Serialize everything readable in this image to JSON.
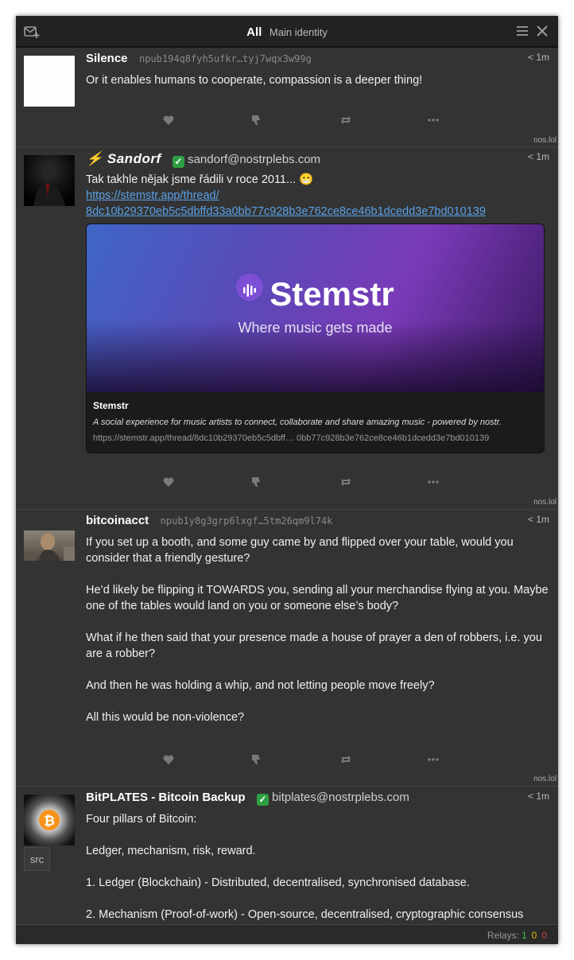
{
  "header": {
    "tab_all": "All",
    "tab_identity": "Main identity"
  },
  "posts": [
    {
      "name": "Silence",
      "npub": "npub194q8fyh5ufkr…tyj7wqx3w99g",
      "time": "< 1m",
      "content": [
        "Or it enables humans to cooperate, compassion is a deeper thing!"
      ],
      "relay": "nos.lol"
    },
    {
      "name": "⚡ Sandorf",
      "nip05": "sandorf@nostrplebs.com",
      "time": "< 1m",
      "text": "Tak takhle nějak jsme řádili v roce 2011... 😁",
      "link_line1": "https://stemstr.app/thread/",
      "link_line2": "8dc10b29370eb5c5dbffd33a0bb77c928b3e762ce8ce46b1dcedd3e7bd010139",
      "preview": {
        "brand": "Stemstr",
        "tagline": "Where music gets made",
        "title": "Stemstr",
        "description": "A social experience for music artists to connect, collaborate and share amazing music - powered by nostr.",
        "url": "https://stemstr.app/thread/8dc10b29370eb5c5dbff… 0bb77c928b3e762ce8ce46b1dcedd3e7bd010139"
      },
      "relay": "nos.lol"
    },
    {
      "name": "bitcoinacct",
      "npub": "npub1y8g3grp6lxgf…5tm26qm9l74k",
      "time": "< 1m",
      "content": [
        "If you set up a booth, and some guy came by and flipped over your table, would you consider that a friendly gesture?",
        "He’d likely be flipping it TOWARDS you, sending all your merchandise flying at you.  Maybe one of the tables would land on you or someone else’s body?",
        "What if he then said that your presence made a house of prayer a den of robbers, i.e. you are a robber?",
        "And then he was holding a whip, and not letting people move freely?",
        "All this would be non-violence?"
      ],
      "relay": "nos.lol"
    },
    {
      "name": "BitPLATES - Bitcoin Backup",
      "nip05": "bitplates@nostrplebs.com",
      "time": "< 1m",
      "src_label": "src",
      "content": [
        "Four pillars of Bitcoin:",
        "Ledger, mechanism, risk, reward.",
        "1. Ledger (Blockchain) - Distributed, decentralised, synchronised database.",
        "2. Mechanism (Proof-of-work) - Open-source, decentralised, cryptographic consensus"
      ]
    }
  ],
  "status": {
    "relays_label": "Relays:",
    "green": "1",
    "yellow": "0",
    "red": "0"
  },
  "colors": {
    "background": "#333333",
    "link": "#5aa0e6",
    "verified": "#2ea043"
  }
}
